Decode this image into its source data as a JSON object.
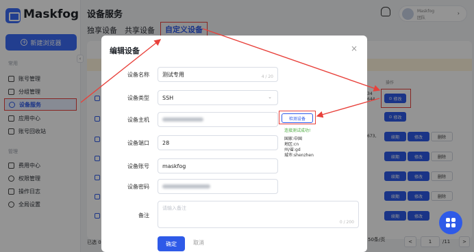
{
  "app": {
    "name": "Maskfog"
  },
  "sidebar": {
    "new_label": "新建浏览器",
    "section_common": "常用",
    "section_manage": "管理",
    "items_common": [
      {
        "label": "账号管理"
      },
      {
        "label": "分组管理"
      },
      {
        "label": "设备服务"
      },
      {
        "label": "应用中心"
      },
      {
        "label": "账号回收站"
      }
    ],
    "items_manage": [
      {
        "label": "费用中心"
      },
      {
        "label": "权限管理"
      },
      {
        "label": "操作日志"
      },
      {
        "label": "全局设置"
      }
    ]
  },
  "header": {
    "title": "设备服务",
    "tabs": [
      {
        "label": "独享设备"
      },
      {
        "label": "共享设备"
      },
      {
        "label": "自定义设备"
      }
    ],
    "user": {
      "line1": "Maskfog",
      "line2": "团队"
    }
  },
  "table": {
    "op_header": "操作",
    "edit": "修改",
    "bind": "续期",
    "delete": "删除",
    "row1_extra": "34\n644",
    "row4_extra": "673,"
  },
  "footer": {
    "total": "已选 0",
    "page_size": "50条/页",
    "page_current": "1",
    "page_total": "/11",
    "prev": "<",
    "next": ">"
  },
  "modal": {
    "title": "编辑设备",
    "close": "×",
    "labels": {
      "name": "设备名称",
      "type": "设备类型",
      "host": "设备主机",
      "port": "设备端口",
      "account": "设备账号",
      "password": "设备密码",
      "note": "备注"
    },
    "values": {
      "name": "测试专用",
      "name_count": "4 / 20",
      "type": "SSH",
      "port": "28",
      "account": "maskfog",
      "note_placeholder": "请输入备注",
      "note_count": "0 / 200"
    },
    "test_button": "检测设备",
    "test_result": {
      "status": "连接测试成功!",
      "country": "国家:中国",
      "region": "地区:cn",
      "province": "州/省:gd",
      "city": "城市:shenzhen"
    },
    "ok": "确定",
    "cancel": "取消"
  },
  "colors": {
    "accent": "#2e5ae8",
    "highlight": "#e8413b",
    "success": "#47a93a"
  }
}
